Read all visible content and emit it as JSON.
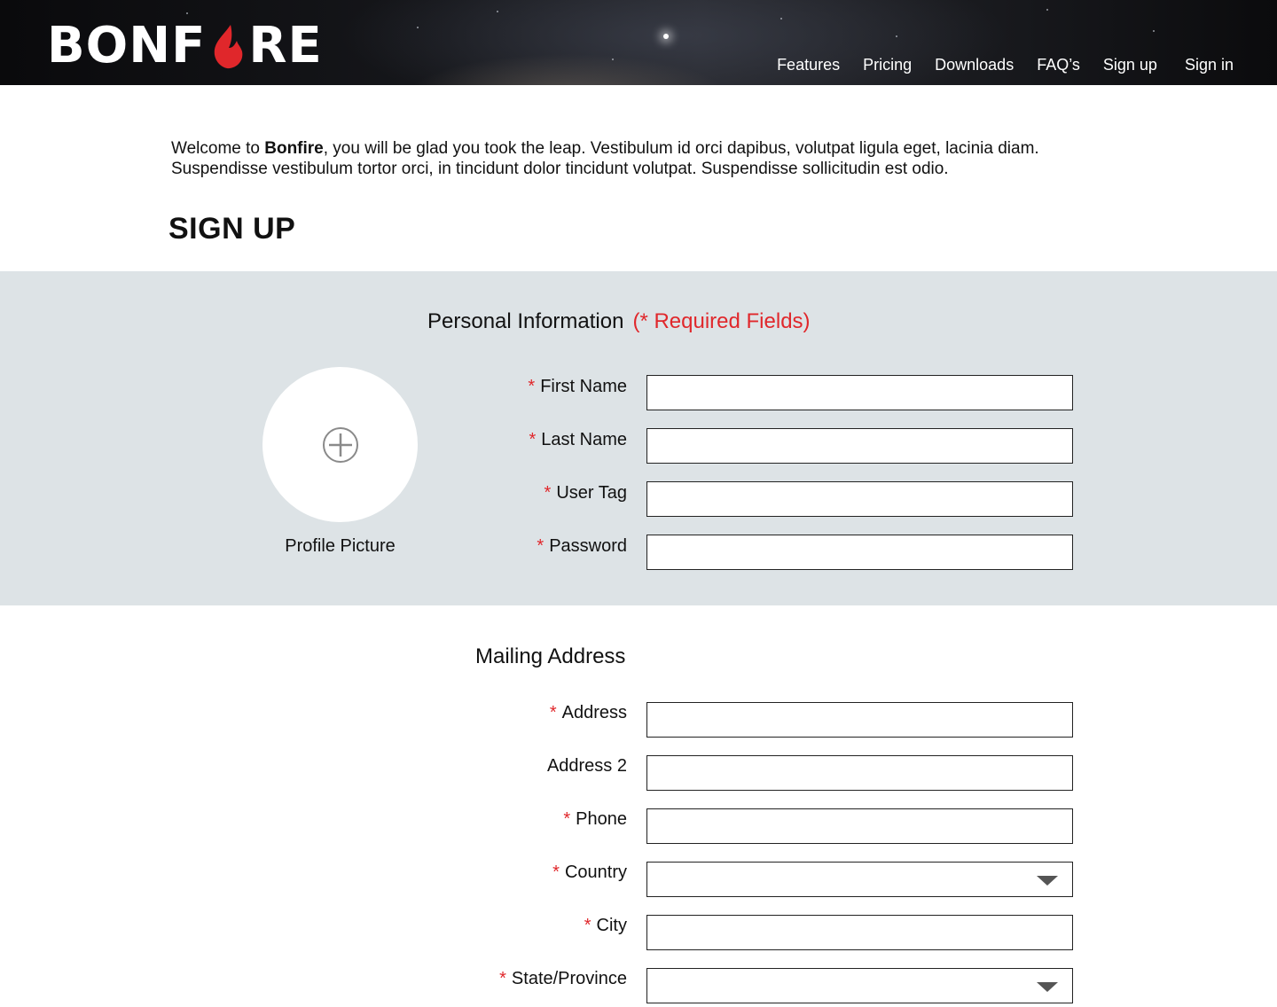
{
  "header": {
    "logo_left": "BONF",
    "logo_right": "RE",
    "logo_flame_icon": "flame-icon",
    "nav": [
      {
        "label": "Features"
      },
      {
        "label": "Pricing"
      },
      {
        "label": "Downloads"
      },
      {
        "label": "FAQ’s"
      },
      {
        "label": "Sign up"
      },
      {
        "label": "Sign in"
      }
    ]
  },
  "intro": {
    "prefix": "Welcome to ",
    "brand": "Bonfire",
    "rest": ", you will be glad you took the leap. Vestibulum id orci dapibus, volutpat ligula eget, lacinia diam. Suspendisse vestibulum tortor orci, in tincidunt dolor tincidunt volutpat. Suspendisse sollicitudin est odio."
  },
  "page_title": "SIGN UP",
  "personal": {
    "title": "Personal Information",
    "required_note": "(* Required Fields)",
    "avatar_icon": "plus-circle-icon",
    "avatar_label": "Profile Picture",
    "fields": [
      {
        "label": "First Name",
        "required": "*",
        "value": ""
      },
      {
        "label": "Last Name",
        "required": "*",
        "value": ""
      },
      {
        "label": "User Tag",
        "required": "*",
        "value": ""
      },
      {
        "label": "Password",
        "required": "*",
        "value": ""
      }
    ]
  },
  "mailing": {
    "title": "Mailing Address",
    "fields": [
      {
        "label": "Address",
        "required": "*",
        "value": ""
      },
      {
        "label": "Address 2",
        "required": "",
        "value": ""
      },
      {
        "label": "Phone",
        "required": "*",
        "value": ""
      },
      {
        "label": "Country",
        "required": "*",
        "value": "",
        "dropdown_icon": "caret-down-icon"
      },
      {
        "label": "City",
        "required": "*",
        "value": ""
      },
      {
        "label": "State/Province",
        "required": "*",
        "value": "",
        "dropdown_icon": "caret-down-icon"
      }
    ]
  },
  "colors": {
    "accent_red": "#e0272b",
    "panel_bg": "#dde3e6"
  }
}
